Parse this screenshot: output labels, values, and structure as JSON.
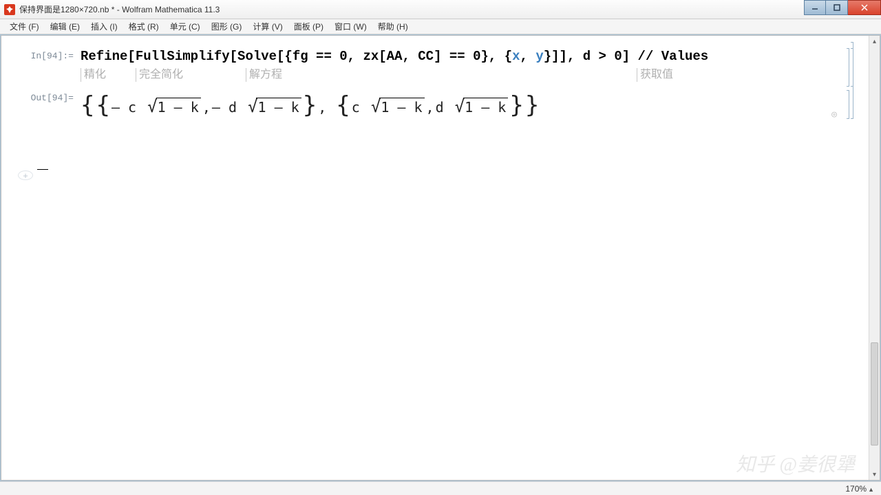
{
  "window": {
    "title": "保持界面是1280×720.nb * - Wolfram Mathematica 11.3"
  },
  "menu": {
    "file": "文件 (F)",
    "edit": "编辑 (E)",
    "insert": "插入 (I)",
    "format": "格式 (R)",
    "cell": "单元 (C)",
    "graphics": "图形 (G)",
    "evaluation": "计算 (V)",
    "palettes": "面板 (P)",
    "window": "窗口 (W)",
    "help": "帮助 (H)"
  },
  "cells": {
    "in_label": "In[94]:=",
    "out_label": "Out[94]=",
    "in_code_prefix": "Refine[FullSimplify[Solve[{fg == 0, zx[AA, CC] == 0}, {",
    "in_var_x": "x",
    "in_comma": ", ",
    "in_var_y": "y",
    "in_code_suffix": "}]], d > 0] // Values",
    "hints": {
      "refine": "精化",
      "fullsimplify": "完全简化",
      "solve": "解方程",
      "values": "获取值"
    },
    "out": {
      "neg_c": "– c",
      "sqrt_body": "1 – k",
      "sep": " , ",
      "neg_d": "– d",
      "pos_c": "c",
      "pos_d": "d"
    }
  },
  "status": {
    "zoom": "170%"
  },
  "watermark": "知乎 @姜很犟"
}
